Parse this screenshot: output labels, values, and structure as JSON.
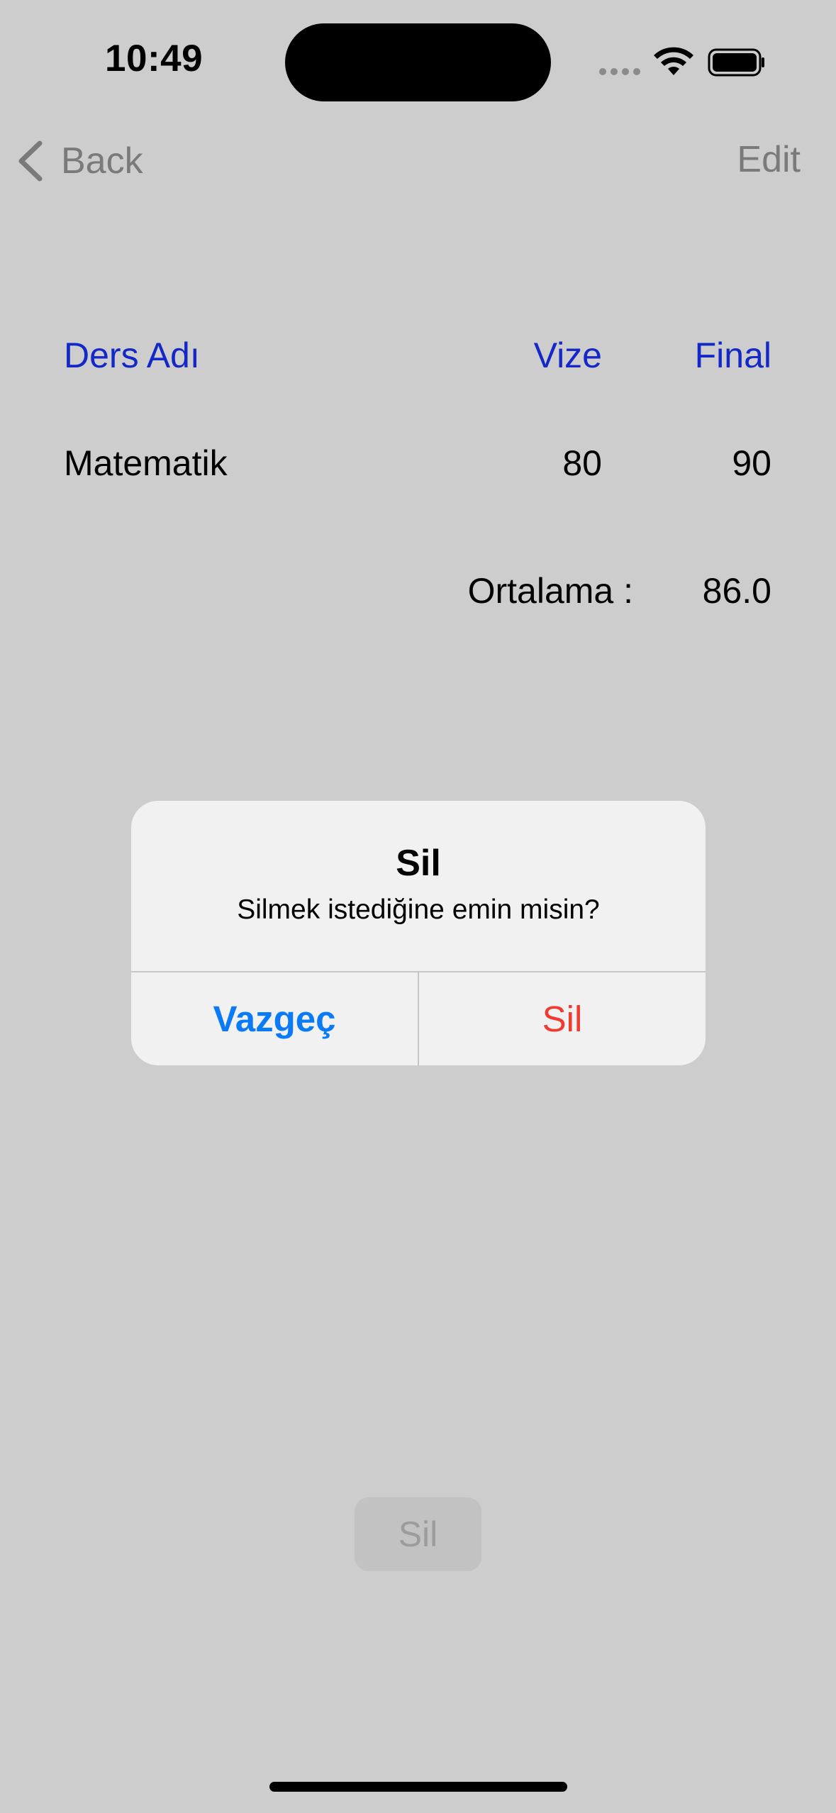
{
  "status_bar": {
    "time": "10:49",
    "icons": [
      "cellular-signal-icon",
      "wifi-icon",
      "battery-icon"
    ]
  },
  "nav": {
    "back_label": "Back",
    "edit_label": "Edit",
    "back_icon": "chevron-left-icon"
  },
  "table": {
    "headers": {
      "name": "Ders Adı",
      "midterm": "Vize",
      "final": "Final"
    },
    "rows": [
      {
        "name": "Matematik",
        "midterm": "80",
        "final": "90"
      }
    ],
    "average_label": "Ortalama :",
    "average_value": "86.0"
  },
  "bottom_button": {
    "label": "Sil"
  },
  "alert": {
    "title": "Sil",
    "message": "Silmek istediğine emin misin?",
    "cancel_label": "Vazgeç",
    "delete_label": "Sil"
  },
  "colors": {
    "background": "#cdcdcd",
    "header_blue": "#1428c8",
    "alert_blue": "#0a7af7",
    "destructive_red": "#f03a2f",
    "nav_gray": "#7a7a7a"
  }
}
